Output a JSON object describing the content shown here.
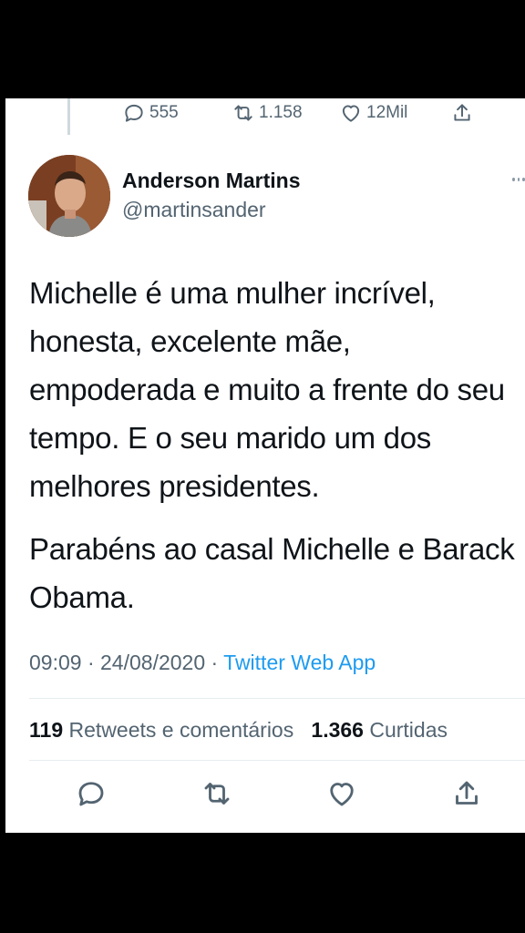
{
  "previous_tweet": {
    "replies": "555",
    "retweets": "1.158",
    "likes": "12Mil"
  },
  "tweet": {
    "author_name": "Anderson Martins",
    "author_handle": "@martinsander",
    "paragraphs": [
      "Michelle é uma mulher incrível, honesta, excelente mãe, empoderada e muito a frente do seu tempo. E o seu marido um dos melhores presidentes.",
      "Parabéns ao casal Michelle e Barack Obama."
    ],
    "time": "09:09",
    "separator": " · ",
    "date": "24/08/2020",
    "source": "Twitter Web App",
    "retweets_count": "119",
    "retweets_label": "Retweets e comentários",
    "likes_count": "1.366",
    "likes_label": "Curtidas"
  },
  "icons": {
    "reply": "reply-icon",
    "retweet": "retweet-icon",
    "like": "heart-icon",
    "share": "share-icon",
    "more": "more-icon"
  },
  "colors": {
    "accent": "#1d9bf0",
    "text": "#0f1419",
    "secondary": "#536471",
    "background": "#ffffff"
  }
}
